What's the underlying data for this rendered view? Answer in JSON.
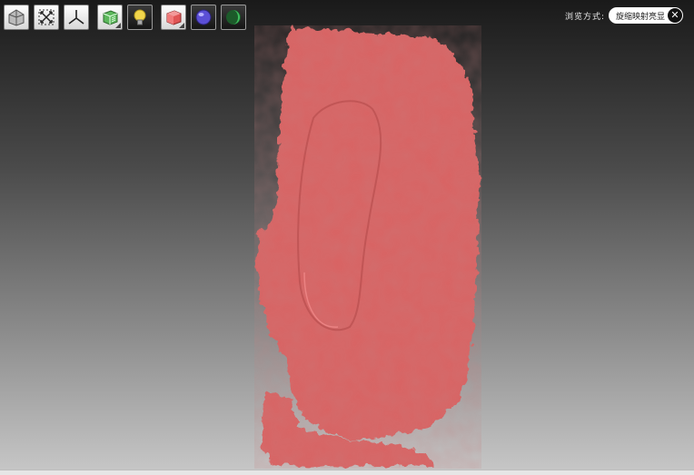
{
  "toolbar": {
    "buttons": [
      {
        "icon": "home-view-icon",
        "style": "light"
      },
      {
        "icon": "fit-all-icon",
        "style": "light"
      },
      {
        "icon": "axes-icon",
        "style": "light"
      },
      {
        "icon": "render-mode-icon",
        "style": "light"
      },
      {
        "icon": "lighting-icon",
        "style": "dark"
      },
      {
        "icon": "material-icon",
        "style": "light"
      },
      {
        "icon": "background-sphere-icon",
        "style": "light"
      },
      {
        "icon": "night-mode-icon",
        "style": "dark"
      }
    ]
  },
  "view_mode": {
    "label": "浏览方式:",
    "selected": "旋缩映射亮显",
    "close_glyph": "✕"
  },
  "model": {
    "color": "#d96464",
    "shade_color": "#b84e4e"
  },
  "colors": {
    "background_top": "#1a1a1a",
    "background_bottom": "#c8c8c8"
  }
}
